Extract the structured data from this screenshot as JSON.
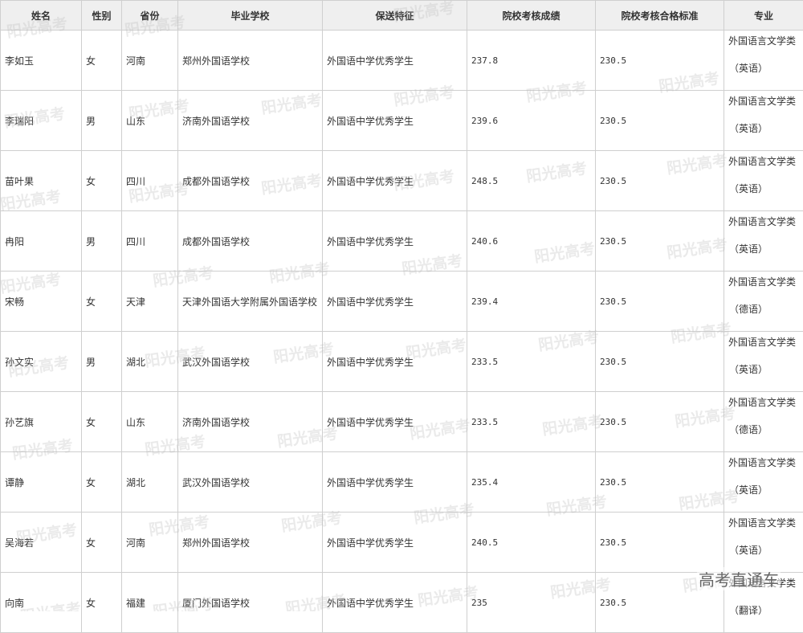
{
  "headers": [
    "姓名",
    "性别",
    "省份",
    "毕业学校",
    "保送特征",
    "院校考核成绩",
    "院校考核合格标准",
    "专业"
  ],
  "rows": [
    {
      "name": "李如玉",
      "gender": "女",
      "province": "河南",
      "school": "郑州外国语学校",
      "feature": "外国语中学优秀学生",
      "score": "237.8",
      "standard": "230.5",
      "major": "外国语言文学类",
      "direction": "（英语）"
    },
    {
      "name": "李瑞阳",
      "gender": "男",
      "province": "山东",
      "school": "济南外国语学校",
      "feature": "外国语中学优秀学生",
      "score": "239.6",
      "standard": "230.5",
      "major": "外国语言文学类",
      "direction": "（英语）"
    },
    {
      "name": "苗叶果",
      "gender": "女",
      "province": "四川",
      "school": "成都外国语学校",
      "feature": "外国语中学优秀学生",
      "score": "248.5",
      "standard": "230.5",
      "major": "外国语言文学类",
      "direction": "（英语）"
    },
    {
      "name": "冉阳",
      "gender": "男",
      "province": "四川",
      "school": "成都外国语学校",
      "feature": "外国语中学优秀学生",
      "score": "240.6",
      "standard": "230.5",
      "major": "外国语言文学类",
      "direction": "（英语）"
    },
    {
      "name": "宋畅",
      "gender": "女",
      "province": "天津",
      "school": "天津外国语大学附属外国语学校",
      "feature": "外国语中学优秀学生",
      "score": "239.4",
      "standard": "230.5",
      "major": "外国语言文学类",
      "direction": "（德语）"
    },
    {
      "name": "孙文实",
      "gender": "男",
      "province": "湖北",
      "school": "武汉外国语学校",
      "feature": "外国语中学优秀学生",
      "score": "233.5",
      "standard": "230.5",
      "major": "外国语言文学类",
      "direction": "（英语）"
    },
    {
      "name": "孙艺旗",
      "gender": "女",
      "province": "山东",
      "school": "济南外国语学校",
      "feature": "外国语中学优秀学生",
      "score": "233.5",
      "standard": "230.5",
      "major": "外国语言文学类",
      "direction": "（德语）"
    },
    {
      "name": "谭静",
      "gender": "女",
      "province": "湖北",
      "school": "武汉外国语学校",
      "feature": "外国语中学优秀学生",
      "score": "235.4",
      "standard": "230.5",
      "major": "外国语言文学类",
      "direction": "（英语）"
    },
    {
      "name": "吴海若",
      "gender": "女",
      "province": "河南",
      "school": "郑州外国语学校",
      "feature": "外国语中学优秀学生",
      "score": "240.5",
      "standard": "230.5",
      "major": "外国语言文学类",
      "direction": "（英语）"
    },
    {
      "name": "向南",
      "gender": "女",
      "province": "福建",
      "school": "厦门外国语学校",
      "feature": "外国语中学优秀学生",
      "score": "235",
      "standard": "230.5",
      "major": "外国语言文学类",
      "direction": "（翻译）"
    }
  ],
  "watermark_text": "阳光高考",
  "corner_logo": "高考直通车"
}
